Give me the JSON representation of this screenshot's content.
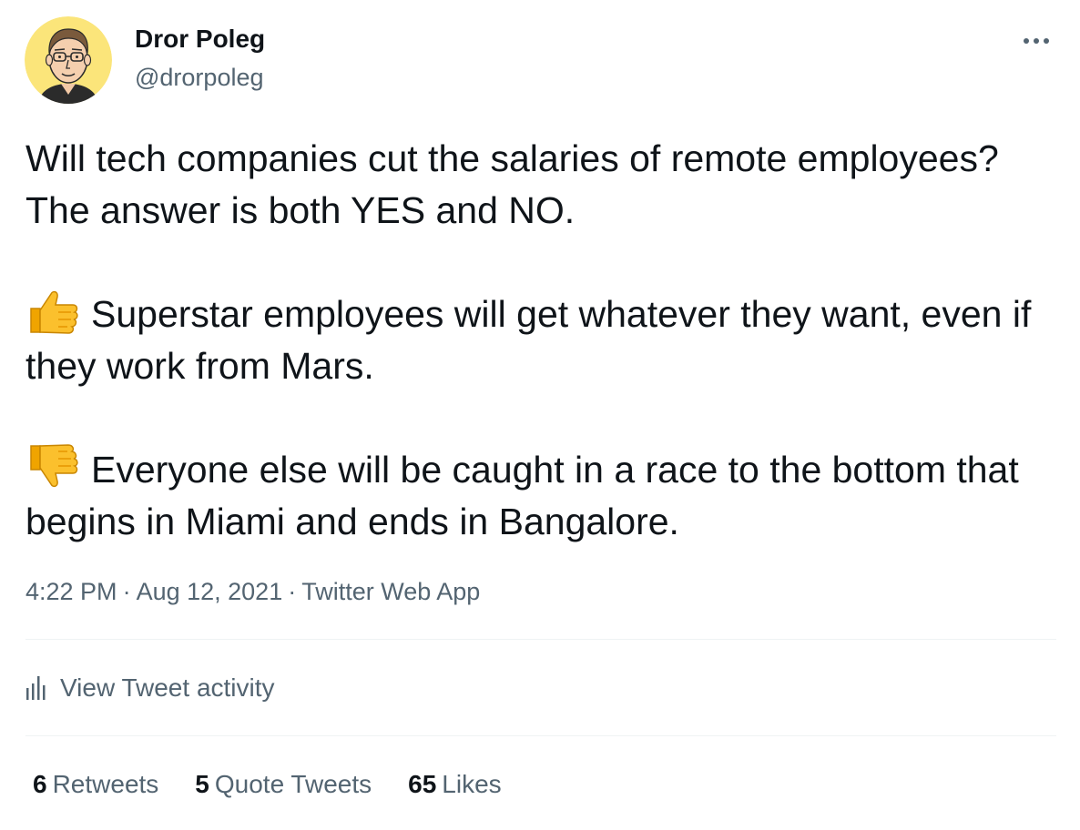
{
  "author": {
    "display_name": "Dror Poleg",
    "handle": "@drorpoleg",
    "avatar_icon": "cartoon-avatar-icon"
  },
  "more_icon": "more-horizontal-icon",
  "tweet": {
    "paragraphs": [
      {
        "emoji": "",
        "text": "Will tech companies cut the salaries of remote employees? The answer is both YES and NO."
      },
      {
        "emoji": "thumbs-up-icon",
        "text": "Superstar employees will get whatever they want, even if they work from Mars."
      },
      {
        "emoji": "thumbs-down-icon",
        "text": "Everyone else will be caught in a race to the bottom that begins in Miami and ends in Bangalore."
      }
    ]
  },
  "meta": {
    "time": "4:22 PM",
    "separator": "·",
    "date": "Aug 12, 2021",
    "source": "Twitter Web App"
  },
  "activity": {
    "icon": "bar-chart-icon",
    "label": "View Tweet activity"
  },
  "stats": {
    "retweets": {
      "count": "6",
      "label": "Retweets"
    },
    "quote_tweets": {
      "count": "5",
      "label": "Quote Tweets"
    },
    "likes": {
      "count": "65",
      "label": "Likes"
    }
  },
  "colors": {
    "text_primary": "#0f1419",
    "text_secondary": "#536471",
    "divider": "#eff3f4",
    "avatar_bg": "#fbe57a",
    "emoji_yellow": "#fbc02d"
  }
}
